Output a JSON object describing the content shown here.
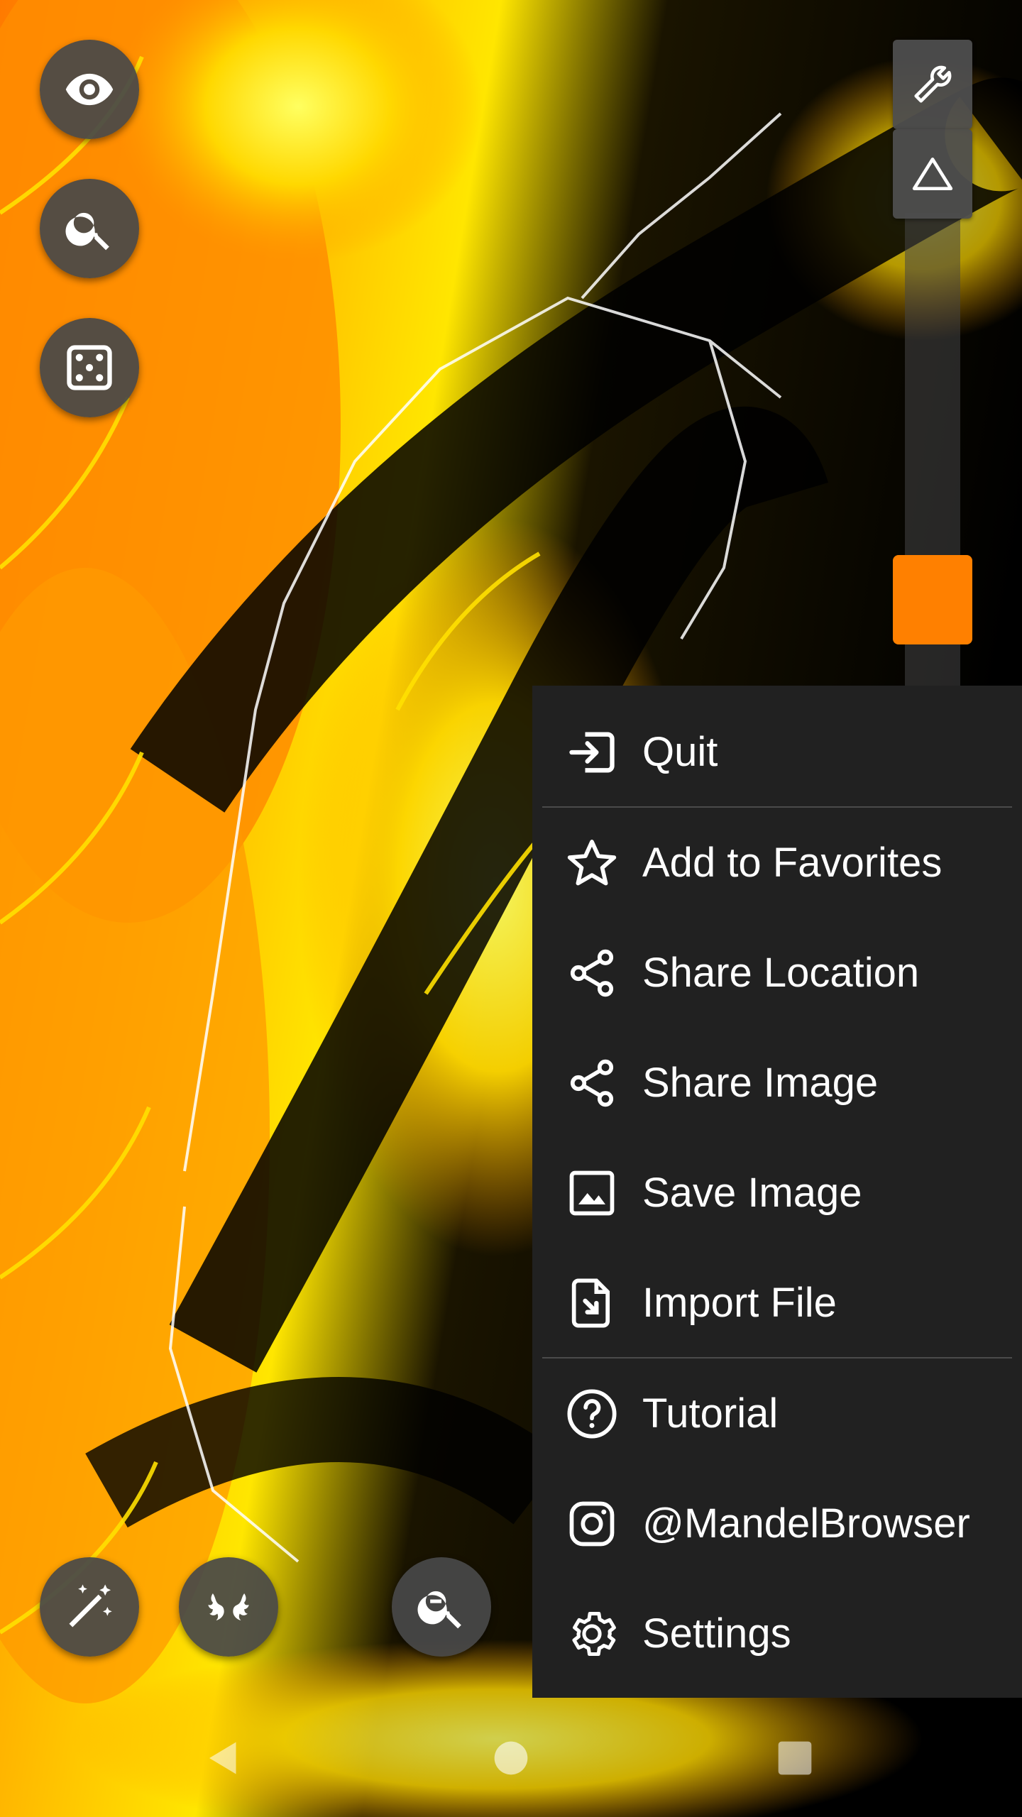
{
  "fabs": {
    "visibility": "eye-icon",
    "search": "search-icon",
    "random": "dice-icon",
    "magic": "magic-wand-icon",
    "julia": "julia-set-icon",
    "zoom_out": "zoom-out-icon"
  },
  "right_panel": {
    "tools": "wrench-icon",
    "toggle": "triangle-icon",
    "swatch_color": "#ff8000"
  },
  "menu": {
    "items": [
      {
        "label": "Quit",
        "icon": "exit-icon"
      },
      {
        "label": "Add to Favorites",
        "icon": "star-icon"
      },
      {
        "label": "Share Location",
        "icon": "share-icon"
      },
      {
        "label": "Share Image",
        "icon": "share-icon"
      },
      {
        "label": "Save Image",
        "icon": "image-icon"
      },
      {
        "label": "Import File",
        "icon": "import-file-icon"
      },
      {
        "label": "Tutorial",
        "icon": "help-icon"
      },
      {
        "label": "@MandelBrowser",
        "icon": "instagram-icon"
      },
      {
        "label": "Settings",
        "icon": "gear-icon"
      }
    ]
  },
  "navbar": {
    "back": "back-icon",
    "home": "home-icon",
    "recents": "recents-icon"
  }
}
